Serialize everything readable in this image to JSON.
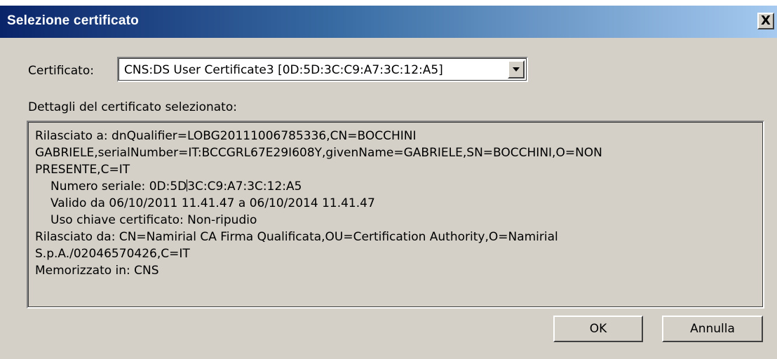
{
  "window": {
    "title": "Selezione certificato",
    "close_label": "X"
  },
  "certificate": {
    "label": "Certificato:",
    "selected": "CNS:DS User Certificate3 [0D:5D:3C:C9:A7:3C:12:A5]"
  },
  "details": {
    "label": "Dettagli del certificato selezionato:",
    "lines": [
      "Rilasciato a: dnQualifier=LOBG20111006785336,CN=BOCCHINI",
      "GABRIELE,serialNumber=IT:BCCGRL67E29I608Y,givenName=GABRIELE,SN=BOCCHINI,O=NON",
      "PRESENTE,C=IT",
      "Numero seriale: 0D:5D",
      "3C:C9:A7:3C:12:A5",
      "Valido da 06/10/2011 11.41.47 a 06/10/2014 11.41.47",
      "Uso chiave certificato: Non-ripudio",
      "Rilasciato da: CN=Namirial CA Firma Qualificata,OU=Certification Authority,O=Namirial",
      "S.p.A./02046570426,C=IT",
      "Memorizzato in: CNS"
    ]
  },
  "buttons": {
    "ok": "OK",
    "cancel": "Annulla"
  },
  "colors": {
    "title_start": "#0a246a",
    "title_end": "#a6caf0",
    "face": "#d4d0c8"
  },
  "icons": {
    "close": "close-icon",
    "dropdown": "chevron-down-icon"
  }
}
